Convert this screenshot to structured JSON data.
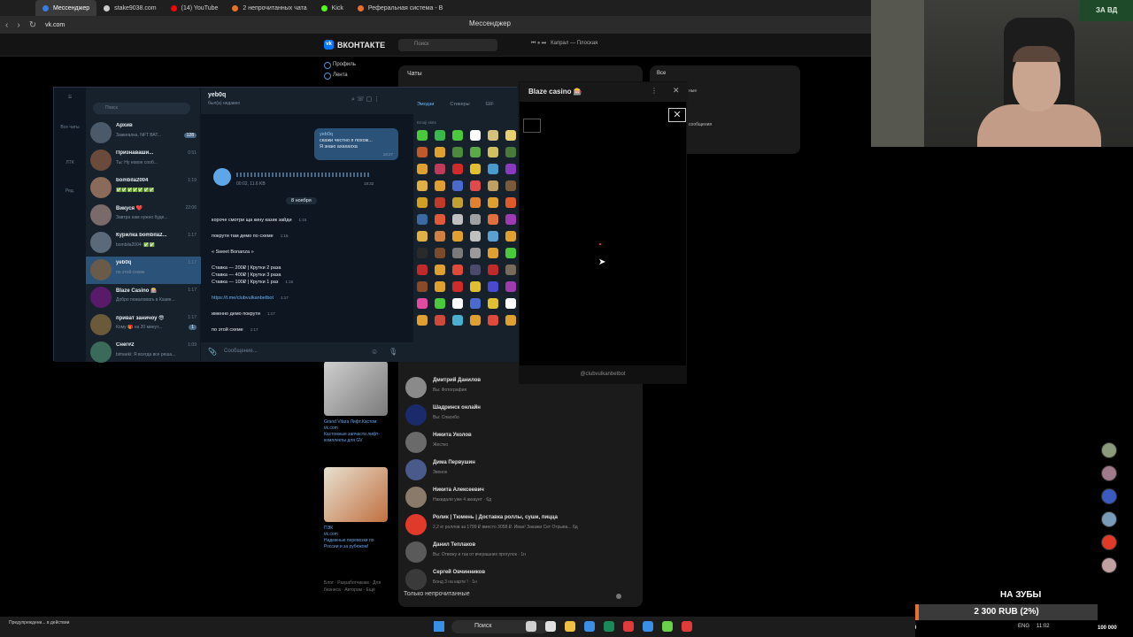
{
  "browser": {
    "tabs": [
      {
        "label": "Мессенджер",
        "active": true,
        "color": "#3a7be0"
      },
      {
        "label": "stake9038.com",
        "active": false,
        "color": "#cccccc"
      },
      {
        "label": "(14) YouTube",
        "active": false,
        "color": "#ff0000"
      },
      {
        "label": "2 непрочитанных чата",
        "active": false,
        "color": "#e8702a"
      },
      {
        "label": "Kick",
        "active": false,
        "color": "#53fc18"
      },
      {
        "label": "Реферальная система - B",
        "active": false,
        "color": "#e8702a"
      }
    ],
    "url": "vk.com",
    "page_title": "Мессенджер"
  },
  "vk": {
    "logo": "ВКОНТАКТЕ",
    "search_placeholder": "Поиск",
    "music": "Капрал — Плоская",
    "nav": [
      "Профиль",
      "Лента"
    ],
    "chats_header": "Чаты",
    "filter_all": "Все",
    "filter_line1": "ные",
    "filter_line2": "сообщения",
    "dialogs": [
      {
        "name": "Дмитрий Данилов",
        "preview": "Вы: Фотография",
        "avatar": "#8a8a8a"
      },
      {
        "name": "Шадринск онлайн",
        "preview": "Вы: Спасибо",
        "avatar": "#1a2a6a"
      },
      {
        "name": "Никита Уколов",
        "preview": "Жесткo",
        "avatar": "#6a6a6a"
      },
      {
        "name": "Дима Первушин",
        "preview": "Звонок",
        "avatar": "#4a5a8a"
      },
      {
        "name": "Никита Алексеевич",
        "preview": "Накидали уже 4 аккаунт · 6д",
        "avatar": "#8a7a6a"
      },
      {
        "name": "Ролик | Тюмень | Доставка роллы, суши, пицца",
        "preview": "2,2 кг роллов за 1799 ₽ вместо 3058 ₽. Иван! Закажи Сет Отрыва... 6д",
        "avatar": "#e03a2a"
      },
      {
        "name": "Данил Теплаков",
        "preview": "Вы: Отвожу и так от вчерашних прогулок · 1н",
        "avatar": "#5a5a5a"
      },
      {
        "name": "Сергей Овчинников",
        "preview": "Бонд 3 на карте ! · 1н",
        "avatar": "#3a3a3a"
      }
    ],
    "ads": [
      {
        "title": "Grand Vitara Лифт.Кастом",
        "domain": "vk.com",
        "text": "Кастомные запчасти лифт-комплекты для GV"
      },
      {
        "title": "ПЭК",
        "domain": "vk.com",
        "text": "Надежные перевозки по России и за рубежом!"
      }
    ],
    "footer": "Блог · Разработчикам · Для бизнеса · Авторам · Ещё",
    "unread_toggle": "Только непрочитанные"
  },
  "telegram": {
    "rail": [
      "Все чаты",
      "ЛТК",
      "Ред."
    ],
    "search_placeholder": "Поиск",
    "chats": [
      {
        "name": "Архив",
        "preview": "Зажигалка, NFT ВАТ...",
        "time": "",
        "badge": "128",
        "selected": false,
        "avatar": "#4b5a6a"
      },
      {
        "name": "Признаваши...",
        "preview": "Ты: Ну новое сооб...",
        "time": "0:51",
        "badge": "",
        "selected": false,
        "avatar": "#6a4a3a"
      },
      {
        "name": "bombila2004",
        "preview": "✅✅✅✅✅✅✅",
        "time": "1:19",
        "badge": "",
        "selected": false,
        "avatar": "#8a6a5a"
      },
      {
        "name": "Викуся ❤️",
        "preview": "Завтра нам нужно буде...",
        "time": "22:06",
        "badge": "",
        "selected": false,
        "avatar": "#7a6a6a"
      },
      {
        "name": "Курилка bombila2...",
        "preview": "bombila2004: ✅✅",
        "time": "1:17",
        "badge": "",
        "selected": false,
        "avatar": "#5a6a7a"
      },
      {
        "name": "yeb0q",
        "preview": "по этой схеме",
        "time": "1:17",
        "badge": "",
        "selected": true,
        "avatar": "#6a5a4a"
      },
      {
        "name": "Blaze Casino 🎰",
        "preview": "Добро пожаловать в Казин...",
        "time": "1:17",
        "badge": "",
        "selected": false,
        "avatar": "#5a1a6a"
      },
      {
        "name": "приват заничоу 😎",
        "preview": "Кому 🎁 на 20 минут...",
        "time": "1:17",
        "badge": "1",
        "selected": false,
        "avatar": "#6a5a3a"
      },
      {
        "name": "Снег#2",
        "preview": "bimaeki: Я всегда все реша...",
        "time": "1:09",
        "badge": "",
        "selected": false,
        "avatar": "#3a6a5a"
      }
    ],
    "conversation": {
      "name": "yeb0q",
      "status": "был(а) недавно",
      "outgoing": [
        "yeb0q",
        "скажи честно я похож...",
        "Я знаю ахахахха"
      ],
      "outgoing_time": "18:27",
      "voice_duration": "00:02, 11.6 KB",
      "voice_time": "18:32",
      "date_separator": "8 ноября",
      "messages": [
        {
          "text": "короче смотри ща кину казик зайди",
          "time": "1:15"
        },
        {
          "text": "покрути там демо по схеме",
          "time": "1:16"
        },
        {
          "text": "« Sweet Bonanza »",
          "time": ""
        },
        {
          "text": "Ставка — 200₽ | Крутки 2 раза",
          "time": ""
        },
        {
          "text": "Ставка — 400₽ | Крутки 3 раза",
          "time": ""
        },
        {
          "text": "Ставка — 100₽ | Крутки 1 раз",
          "time": "1:16"
        },
        {
          "text": "https://t.me/clubvulkanbetbot",
          "time": "1:17"
        },
        {
          "text": "именно демо покрути",
          "time": "1:17"
        },
        {
          "text": "по этой схеме",
          "time": "1:17"
        }
      ],
      "compose_placeholder": "Сообщение..."
    },
    "panel_tabs": [
      "Эмодзи",
      "Стикеры",
      "GIF"
    ],
    "panel_section": "Emoji slots",
    "emoji_colors": [
      "#4aca3a",
      "#3aba4a",
      "#4aca3a",
      "#ffffff",
      "#d4c27a",
      "#e8d070",
      "#c05a2a",
      "#e0a030",
      "#4a8a3a",
      "#5aaa4a",
      "#d0c060",
      "#4a7a3a",
      "#e0a030",
      "#c03a5a",
      "#d02a2a",
      "#e0c030",
      "#4a9ad0",
      "#8a3ac0",
      "#e0b040",
      "#e0a030",
      "#4a6ad0",
      "#e04a4a",
      "#c0a060",
      "#7a5a3a",
      "#d0a020",
      "#c03a2a",
      "#c0a030",
      "#e08030",
      "#e0a030",
      "#e05a2a",
      "#3a6aa0",
      "#e05a3a",
      "#c0c0c0",
      "#a0a0a0",
      "#e07040",
      "#a03ab0",
      "#e0b040",
      "#d08040",
      "#e0a030",
      "#c0c0c0",
      "#5aa0d0",
      "#e0a030",
      "#2a2a2a",
      "#7a4a2a",
      "#7a7a7a",
      "#9a9a9a",
      "#e0a030",
      "#4aca3a",
      "#c02a2a",
      "#e0a030",
      "#e04a3a",
      "#4a4a6a",
      "#c02a2a",
      "#7a6a5a",
      "#8a4a2a",
      "#e0a030",
      "#d02a2a",
      "#e0c030",
      "#4a4ad0",
      "#a03ab0",
      "#e04aa0",
      "#4aca3a",
      "#ffffff",
      "#4a6ad0",
      "#e0c030",
      "#ffffff",
      "#e0a030",
      "#d04a3a",
      "#4ab0d0",
      "#e0a030",
      "#e04a3a",
      "#e0a030"
    ]
  },
  "blaze": {
    "title": "Blaze casino 🎰",
    "footer": "@clubvulkanbetbot"
  },
  "stream": {
    "flag_text": "ЗА ВД",
    "donation_title": "НА ЗУБЫ",
    "donation_text": "2 300 RUB (2%)",
    "donation_progress": 0.02,
    "donation_min": "0",
    "donation_max": "100 000",
    "right_avatars": [
      "#8a9a7a",
      "#a07a8a",
      "#3a5ac0",
      "#7a9aba",
      "#e03a2a",
      "#c0a0a0"
    ]
  },
  "taskbar": {
    "warning": "Предупреждени... в действии",
    "search": "Поиск",
    "icons": [
      "#d0d0d0",
      "#e0e0e0",
      "#f0c040",
      "#3a8ee6",
      "#1a8a5a",
      "#e03a3a",
      "#3a8ee6",
      "#6ad04a",
      "#e03a3a"
    ],
    "tray": [
      "ENG",
      "11:02"
    ]
  }
}
